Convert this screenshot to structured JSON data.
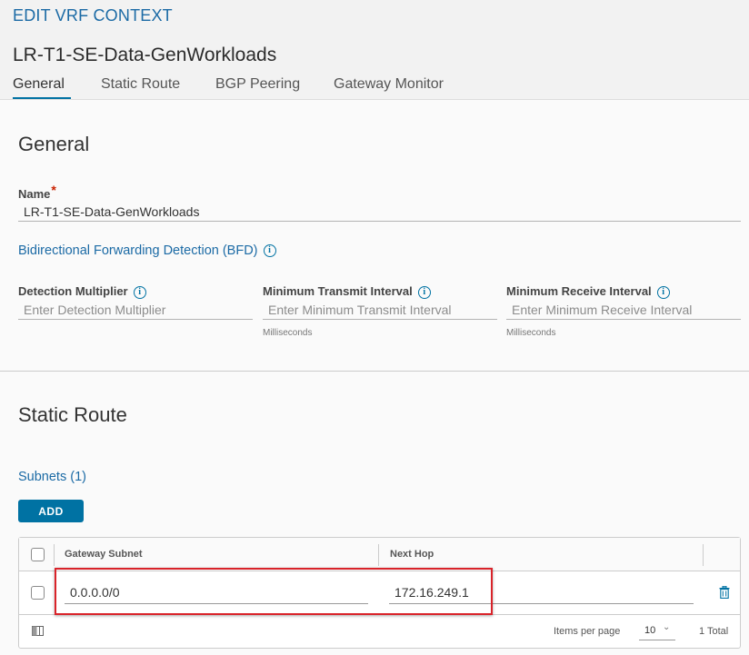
{
  "modal": {
    "title": "EDIT VRF CONTEXT",
    "vrf_name": "LR-T1-SE-Data-GenWorkloads"
  },
  "tabs": [
    {
      "label": "General",
      "active": true
    },
    {
      "label": "Static Route",
      "active": false
    },
    {
      "label": "BGP Peering",
      "active": false
    },
    {
      "label": "Gateway Monitor",
      "active": false
    }
  ],
  "general": {
    "section_title": "General",
    "name_label": "Name",
    "name_required_mark": "*",
    "name_value": "LR-T1-SE-Data-GenWorkloads",
    "bfd_link": "Bidirectional Forwarding Detection (BFD)",
    "detection_multiplier": {
      "label": "Detection Multiplier",
      "placeholder": "Enter Detection Multiplier"
    },
    "min_transmit": {
      "label": "Minimum Transmit Interval",
      "placeholder": "Enter Minimum Transmit Interval",
      "hint": "Milliseconds"
    },
    "min_receive": {
      "label": "Minimum Receive Interval",
      "placeholder": "Enter Minimum Receive Interval",
      "hint": "Milliseconds"
    }
  },
  "static_route": {
    "section_title": "Static Route",
    "subnets_link": "Subnets (1)",
    "add_button": "ADD",
    "columns": [
      "Gateway Subnet",
      "Next Hop"
    ],
    "rows": [
      {
        "gateway_subnet": "0.0.0.0/0",
        "next_hop": "172.16.249.1"
      }
    ],
    "footer": {
      "items_per_page_label": "Items per page",
      "items_per_page_value": "10",
      "total": "1 Total"
    }
  },
  "colors": {
    "accent": "#0072a3",
    "title_blue": "#1b6aa5",
    "highlight_red": "#d9232a"
  },
  "icons": [
    "info-icon",
    "trash-icon",
    "column-toggle-icon",
    "chevron-down-icon"
  ]
}
